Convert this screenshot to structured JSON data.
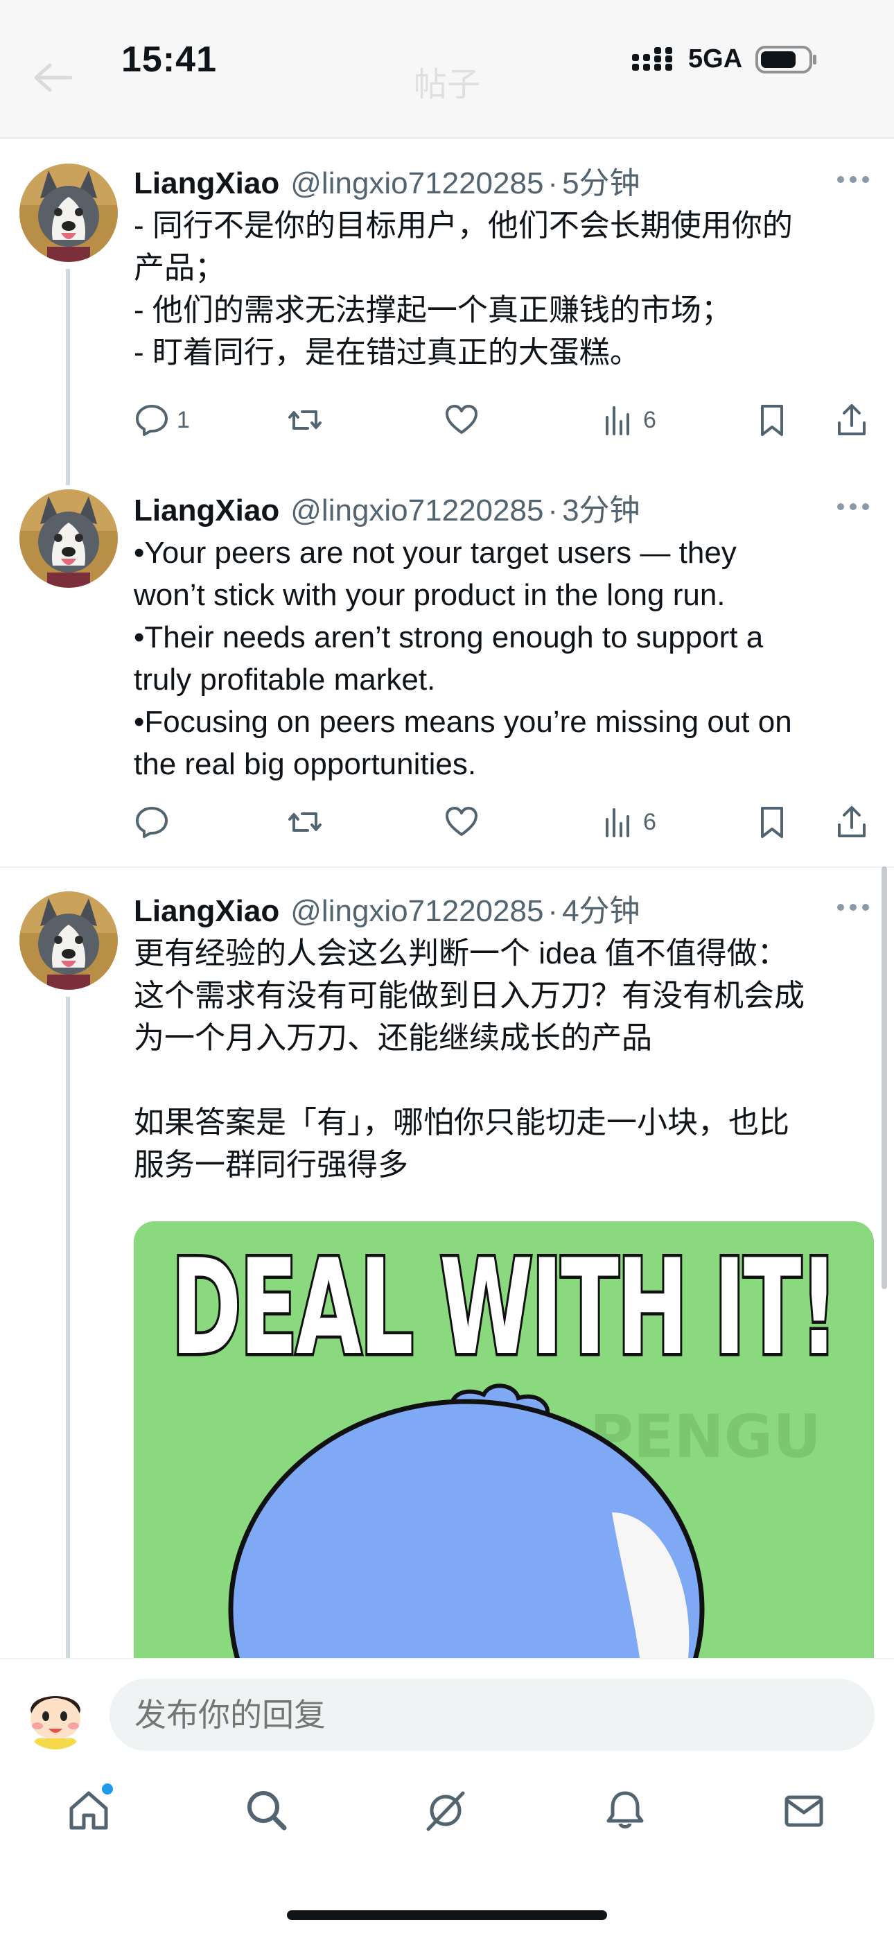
{
  "status_bar": {
    "time": "15:41",
    "network": "5GA"
  },
  "header": {
    "title": "帖子"
  },
  "tweets": [
    {
      "name": "LiangXiao",
      "handle": "@lingxio71220285",
      "dot": "·",
      "time": "5分钟",
      "text": "- 同行不是你的目标用户，他们不会长期使用你的\n产品；\n- 他们的需求无法撑起一个真正赚钱的市场；\n- 盯着同行，是在错过真正的大蛋糕。",
      "replies": "1",
      "views": "6"
    },
    {
      "name": "LiangXiao",
      "handle": "@lingxio71220285",
      "dot": "·",
      "time": "3分钟",
      "text": "•Your peers are not your target users — they\nwon’t stick with your product in the long run.\n•Their needs aren’t strong enough to support a\ntruly profitable market.\n•Focusing on peers means you’re missing out on\nthe real big opportunities.",
      "replies": "",
      "views": "6"
    },
    {
      "name": "LiangXiao",
      "handle": "@lingxio71220285",
      "dot": "·",
      "time": "4分钟",
      "text": "更有经验的人会这么判断一个 idea 值不值得做：\n这个需求有没有可能做到日入万刀？有没有机会成\n为一个月入万刀、还能继续成长的产品\n\n如果答案是「有」，哪怕你只能切走一小块，也比\n服务一群同行强得多",
      "media": {
        "caption": "DEAL WITH IT!",
        "watermark": "PENGU"
      }
    }
  ],
  "reply_bar": {
    "placeholder": "发布你的回复"
  },
  "tabbar": {
    "items": [
      {
        "icon": "home-icon"
      },
      {
        "icon": "search-icon"
      },
      {
        "icon": "grok-icon"
      },
      {
        "icon": "notifications-icon"
      },
      {
        "icon": "messages-icon"
      }
    ]
  },
  "colors": {
    "accent": "#1d9bf0",
    "text": "#0f1419",
    "secondary": "#536471",
    "media_bg": "#8bd97e",
    "pengu": "#7fa8f5"
  }
}
